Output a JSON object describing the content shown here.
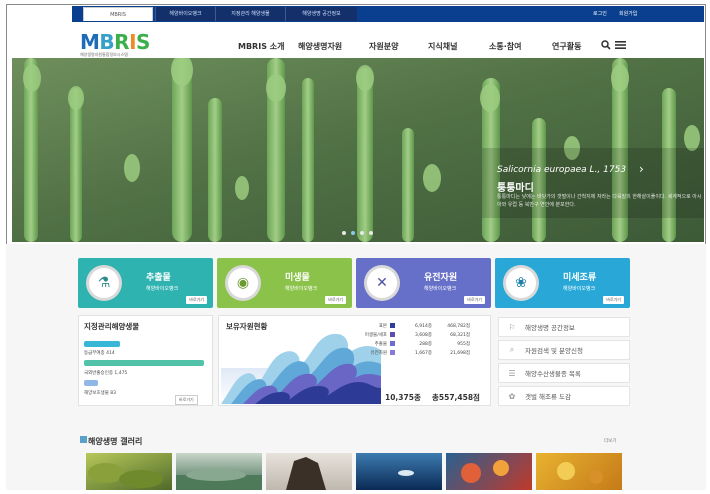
{
  "header": {
    "tabs": [
      "MBRIS",
      "해양바이오뱅크",
      "지정관리 해양생물",
      "해양생명 공간정보"
    ],
    "login": "로그인",
    "join": "회원가입"
  },
  "logo": {
    "text": [
      "M",
      "B",
      "R",
      "I",
      "S"
    ],
    "subtitle": "해양생명자원통합정보시스템"
  },
  "nav": {
    "items": [
      "MBRIS 소개",
      "해양생명자원",
      "자원분양",
      "지식채널",
      "소통·참여",
      "연구활동"
    ],
    "search_icon": "search-icon",
    "menu_icon": "hamburger-icon"
  },
  "hero": {
    "species": "Salicornia europaea L., 1753",
    "common_name": "퉁퉁마디",
    "description": "퉁퉁마디는 낮에는 바닷가의 갯벌이나 간척지에 자라는 다육질의 한해살이풀이다. 세계적으로 아시아와 유럽 등 북반구 연안에 분포한다.",
    "slides": 4,
    "active_slide": 2
  },
  "categories": [
    {
      "title": "추출물",
      "subtitle": "해양바이오뱅크",
      "more": "바로가기",
      "color": "#2eb3b0",
      "icon": "flask-icon",
      "glyph": "⚗"
    },
    {
      "title": "미생물",
      "subtitle": "해양바이오뱅크",
      "more": "바로가기",
      "color": "#8bc34a",
      "icon": "petri-dish-icon",
      "glyph": "◉"
    },
    {
      "title": "유전자원",
      "subtitle": "해양바이오뱅크",
      "more": "바로가기",
      "color": "#6670c8",
      "icon": "dna-icon",
      "glyph": "✕"
    },
    {
      "title": "미세조류",
      "subtitle": "해양바이오뱅크",
      "more": "바로가기",
      "color": "#29a8d8",
      "icon": "algae-icon",
      "glyph": "❀"
    }
  ],
  "designated": {
    "title": "지정관리해양생물",
    "rows": [
      {
        "label": "등급부여종 414",
        "color": "#37b6d6"
      },
      {
        "label": "국외반출승인종 1,475",
        "color": "#52c2a8"
      },
      {
        "label": "해양보호생물 83",
        "color": "#8fb8e6"
      }
    ],
    "more": "바로가기"
  },
  "holdings": {
    "title": "보유자원현황",
    "legend": [
      {
        "name": "표본",
        "species": "6,914종",
        "count": "468,782점",
        "color": "#2c3e9a"
      },
      {
        "name": "미생물/세포",
        "species": "3,608종",
        "count": "68,321점",
        "color": "#5b4fb0"
      },
      {
        "name": "추출물",
        "species": "288종",
        "count": "955점",
        "color": "#6d6ad0"
      },
      {
        "name": "유전자원",
        "species": "1,667종",
        "count": "21,698점",
        "color": "#8a7ad8"
      }
    ],
    "total_species": "10,375종",
    "total_count": "총557,458점"
  },
  "quick_links": [
    {
      "label": "해양생명 공간정보",
      "icon": "map-icon",
      "glyph": "⚐"
    },
    {
      "label": "자원검색 및 분양신청",
      "icon": "search-doc-icon",
      "glyph": "⌕"
    },
    {
      "label": "해양수산생물종 목록",
      "icon": "list-icon",
      "glyph": "☰"
    },
    {
      "label": "갯벌 해조류 도감",
      "icon": "leaf-icon",
      "glyph": "✿"
    }
  ],
  "gallery": {
    "title": "해양생명 갤러리",
    "more": "더보기",
    "thumbs": [
      {
        "name": "algae-photo",
        "colors": [
          "#4f6a2a",
          "#b7c85a"
        ]
      },
      {
        "name": "coast-photo",
        "colors": [
          "#3e6a52",
          "#c9d6c8"
        ]
      },
      {
        "name": "rock-photo",
        "colors": [
          "#3a3028",
          "#e7e2dc"
        ]
      },
      {
        "name": "fish-photo",
        "colors": [
          "#0a2a55",
          "#3d7bb0"
        ]
      },
      {
        "name": "coral-photo",
        "colors": [
          "#c0392b",
          "#2a6090"
        ]
      },
      {
        "name": "sponge-photo",
        "colors": [
          "#e8b230",
          "#c57a18"
        ]
      }
    ]
  }
}
